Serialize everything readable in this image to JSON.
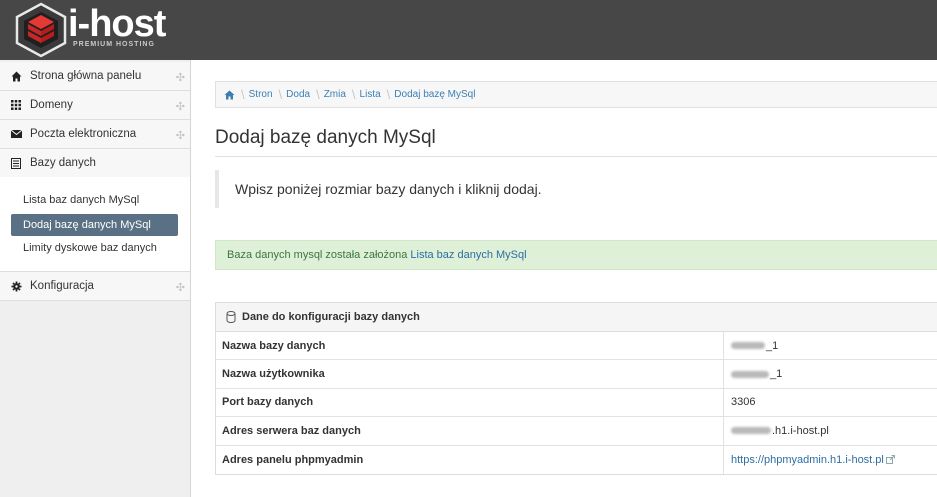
{
  "brand": {
    "name": "i-host",
    "tagline": "PREMIUM HOSTING"
  },
  "sidebar": {
    "items": [
      {
        "label": "Strona główna panelu",
        "icon": "home-icon"
      },
      {
        "label": "Domeny",
        "icon": "grid-icon"
      },
      {
        "label": "Poczta elektroniczna",
        "icon": "envelope-icon"
      },
      {
        "label": "Bazy danych",
        "icon": "list-icon"
      },
      {
        "label": "Konfiguracja",
        "icon": "gear-icon"
      }
    ],
    "submenu": [
      {
        "label": "Lista baz danych MySql"
      },
      {
        "label": "Dodaj bazę danych MySql",
        "active": true
      },
      {
        "label": "Limity dyskowe baz danych"
      }
    ]
  },
  "breadcrumb": {
    "items": [
      "Stron",
      "Doda",
      "Zmia",
      "Lista"
    ],
    "current": "Dodaj bazę MySql"
  },
  "main": {
    "title": "Dodaj bazę danych MySql",
    "lead": "Wpisz poniżej rozmiar bazy danych i kliknij dodaj.",
    "alert": {
      "text": "Baza danych mysql została założona",
      "link": "Lista baz danych MySql"
    }
  },
  "panel": {
    "title": "Dane do konfiguracji bazy danych",
    "rows": [
      {
        "key": "Nazwa bazy danych",
        "value": "_1"
      },
      {
        "key": "Nazwa użytkownika",
        "value": "_1"
      },
      {
        "key": "Port bazy danych",
        "value": "3306"
      },
      {
        "key": "Adres serwera baz danych",
        "value": ".h1.i-host.pl"
      },
      {
        "key": "Adres panelu phpmyadmin",
        "value": "https://phpmyadmin.h1.i-host.pl"
      }
    ]
  },
  "colors": {
    "header": "#474747",
    "accent": "#d32f2f",
    "active": "#5a7084",
    "link": "#2d6da3"
  }
}
